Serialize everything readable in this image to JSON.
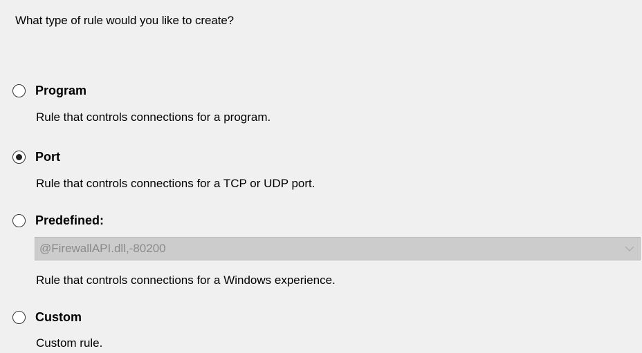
{
  "prompt": "What type of rule would you like to create?",
  "options": [
    {
      "label": "Program",
      "description": "Rule that controls connections for a program.",
      "selected": false
    },
    {
      "label": "Port",
      "description": "Rule that controls connections for a TCP or UDP port.",
      "selected": true
    },
    {
      "label": "Predefined:",
      "description": "Rule that controls connections for a Windows experience.",
      "selected": false
    },
    {
      "label": "Custom",
      "description": "Custom rule.",
      "selected": false
    }
  ],
  "predefined_dropdown": {
    "value": "@FirewallAPI.dll,-80200",
    "enabled": false,
    "icon": "chevron-down-icon"
  },
  "colors": {
    "background": "#f0f0f0",
    "dropdown_disabled_bg": "#cccccc",
    "disabled_text": "#8a8a8a"
  }
}
